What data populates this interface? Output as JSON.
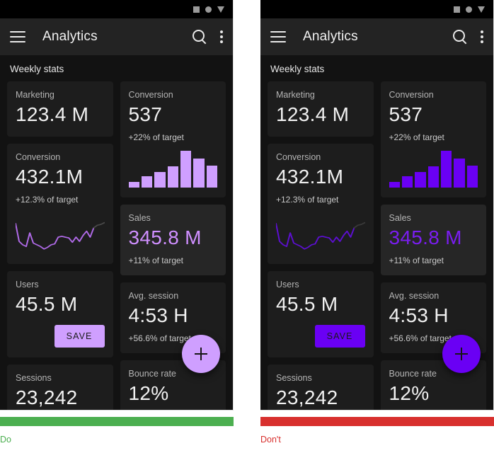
{
  "meta": {
    "statusbar_icons": [
      "square-icon",
      "circle-icon",
      "triangle-icon"
    ]
  },
  "appbar": {
    "menu_icon": "hamburger-menu-icon",
    "title": "Analytics",
    "search_icon": "search-icon",
    "overflow_icon": "more-vertical-icon"
  },
  "section": {
    "label": "Weekly stats"
  },
  "cards": {
    "marketing": {
      "label": "Marketing",
      "value": "123.4 M"
    },
    "conversion_count": {
      "label": "Conversion",
      "value": "537",
      "sub": "+22% of target"
    },
    "conversion_amt": {
      "label": "Conversion",
      "value": "432.1M",
      "sub": "+12.3% of target"
    },
    "sales": {
      "label": "Sales",
      "value": "345.8 M",
      "sub": "+11% of target"
    },
    "users": {
      "label": "Users",
      "value": "45.5 M"
    },
    "avg_session": {
      "label": "Avg. session",
      "value": "4:53 H",
      "sub": "+56.6% of target"
    },
    "sessions": {
      "label": "Sessions",
      "value": "23,242"
    },
    "bounce_rate": {
      "label": "Bounce rate",
      "value": "12%"
    }
  },
  "actions": {
    "save_label": "SAVE",
    "fab_icon": "plus-icon"
  },
  "chart_data": [
    {
      "type": "bar",
      "name": "conversion-sparkline-bars",
      "categories": [
        "1",
        "2",
        "3",
        "4",
        "5",
        "6",
        "7"
      ],
      "values": [
        14,
        28,
        40,
        54,
        92,
        72,
        56
      ],
      "title": "",
      "xlabel": "",
      "ylabel": "",
      "ylim": [
        0,
        100
      ]
    },
    {
      "type": "line",
      "name": "conversion-sparkline-line",
      "x": [
        0,
        4,
        8,
        12,
        16,
        20,
        24,
        28,
        32,
        36,
        40,
        44,
        48,
        52,
        56,
        60,
        64,
        68,
        72,
        76,
        80,
        84,
        88,
        92,
        96,
        100
      ],
      "y": [
        72,
        30,
        22,
        18,
        50,
        26,
        22,
        18,
        12,
        16,
        22,
        24,
        40,
        42,
        40,
        38,
        28,
        40,
        30,
        44,
        54,
        40,
        62,
        68,
        70,
        74
      ],
      "title": "",
      "xlabel": "",
      "ylabel": "",
      "ylim": [
        0,
        100
      ]
    }
  ],
  "panels": {
    "do": {
      "verdict_label": "Do",
      "verdict_color": "#4caf50",
      "accent": "#cf9fff",
      "accent_text": "#cf8fff",
      "line_color": "#b06ae8",
      "line_tail_color": "#4a4a4a"
    },
    "dont": {
      "verdict_label": "Don't",
      "verdict_color": "#d8302e",
      "accent": "#6a00f4",
      "accent_text": "#7a1df0",
      "line_color": "#5c0fd0",
      "line_tail_color": "#3a3a3a"
    }
  }
}
